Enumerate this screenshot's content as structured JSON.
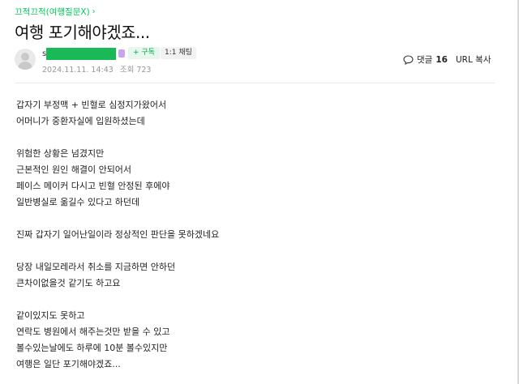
{
  "category": {
    "label": "끄적끄적(여행질문X)",
    "chevron_icon": "chevron-right-icon"
  },
  "post": {
    "title": "여행 포기해야겠죠...",
    "author": {
      "initial": "s",
      "avatar_icon": "default-user-avatar-icon"
    },
    "buttons": {
      "follow": "+ 구독",
      "chat": "1:1 채팅"
    },
    "meta": {
      "datetime": "2024.11.11. 14:43",
      "views": "조회 723"
    },
    "comments": {
      "label": "댓글",
      "count": "16",
      "icon": "comment-bubble-icon"
    },
    "url_copy": "URL 복사",
    "body_lines": [
      "갑자기 부정맥 + 빈혈로 심정지가왔어서",
      "어머니가 중환자실에 입원하셨는데",
      "",
      "위험한 상황은 넘겼지만",
      "근본적인 원인 해결이 안되어서",
      "페이스 메이커 다시고 빈혈 안정된 후에야",
      "일반병실로 옮길수 있다고 하던데",
      "",
      "진짜 갑자기 일어난일이라 정상적인 판단을 못하겠네요",
      "",
      "당장 내일모레라서 취소를 지금하면 안하던",
      "큰차이없을것 같기도 하고요",
      "",
      "같이있지도 못하고",
      "연락도 병원에서 해주는것만 받을 수 있고",
      "볼수있는날에도 하루에 10분 볼수있지만",
      "여행은 일단 포기해야겠죠..."
    ]
  },
  "colors": {
    "accent": "#03c75a",
    "mask": "#18b956",
    "badge": "#c8a6ef",
    "meta_text": "#979797"
  }
}
